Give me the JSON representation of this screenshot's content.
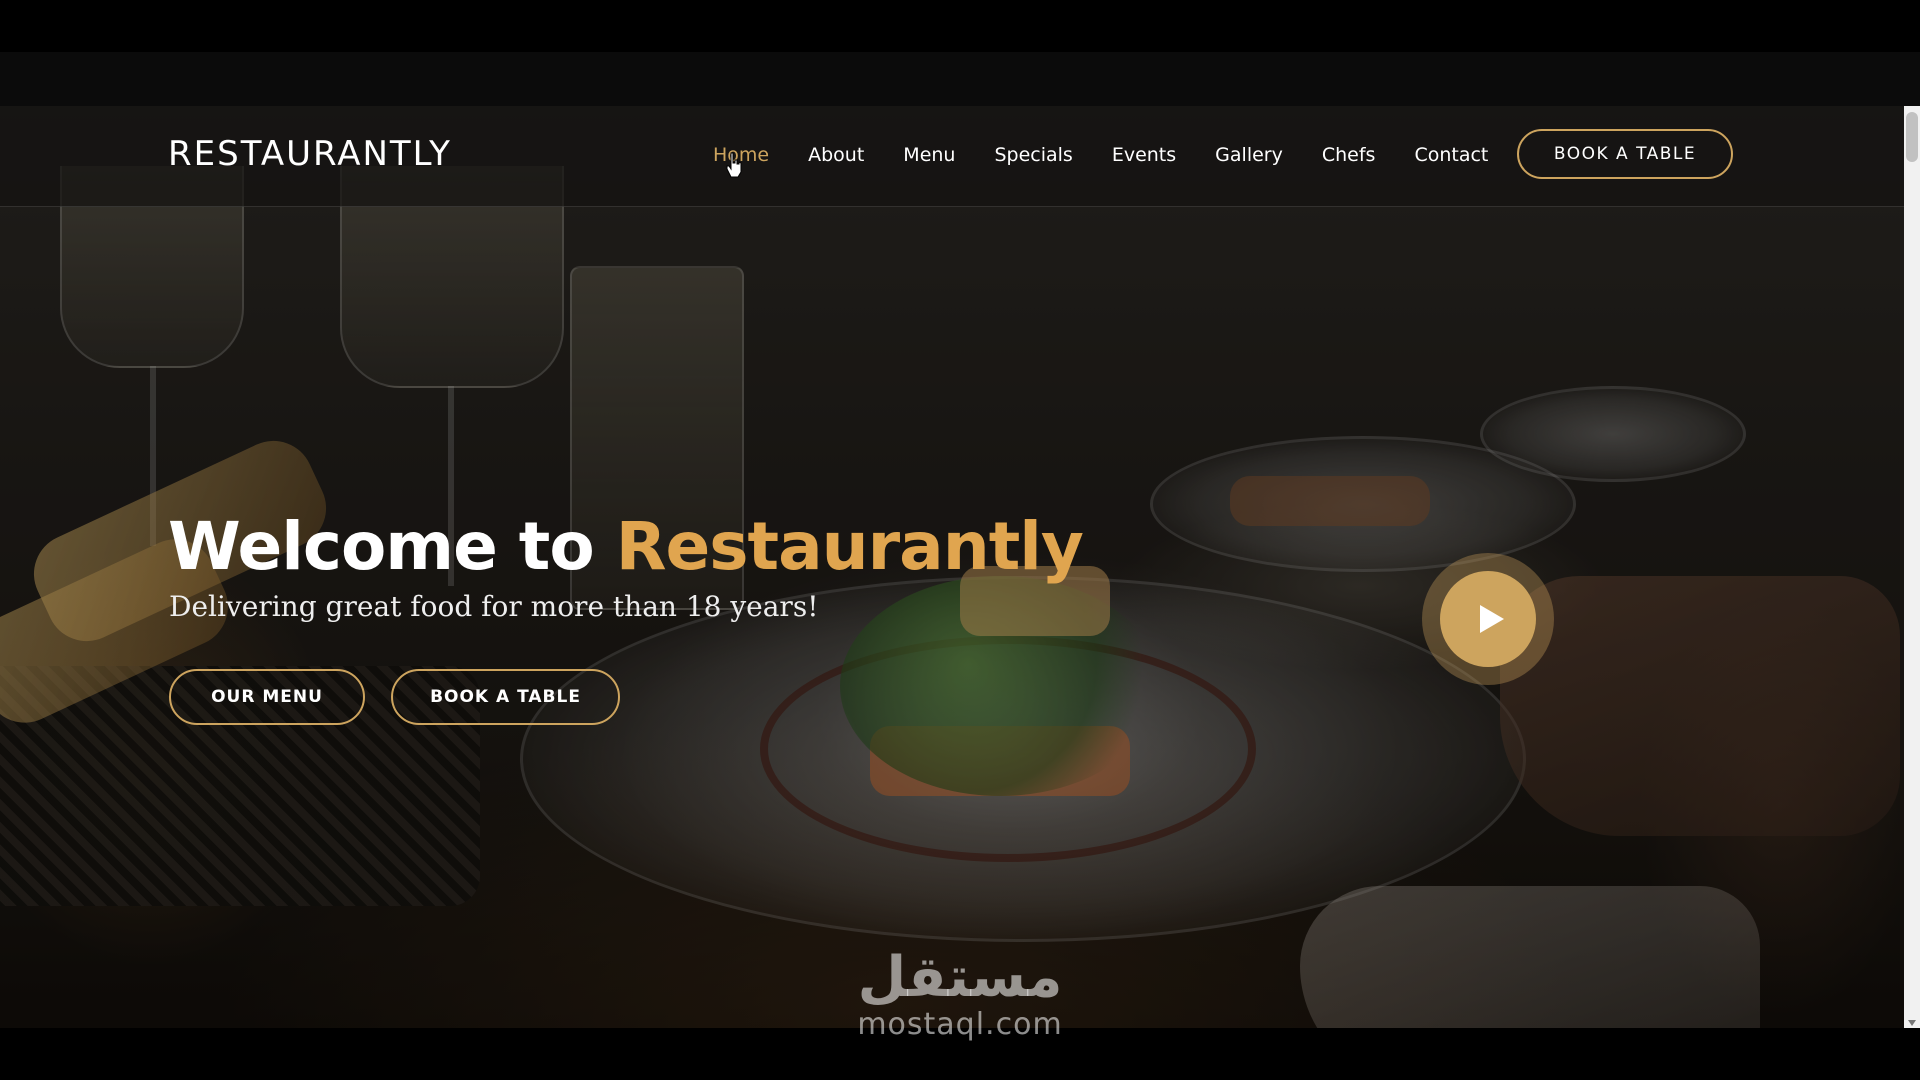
{
  "header": {
    "logo": "RESTAURANTLY",
    "nav": [
      {
        "label": "Home",
        "active": true
      },
      {
        "label": "About",
        "active": false
      },
      {
        "label": "Menu",
        "active": false
      },
      {
        "label": "Specials",
        "active": false
      },
      {
        "label": "Events",
        "active": false
      },
      {
        "label": "Gallery",
        "active": false
      },
      {
        "label": "Chefs",
        "active": false
      },
      {
        "label": "Contact",
        "active": false
      }
    ],
    "cta_label": "BOOK A TABLE"
  },
  "hero": {
    "title_prefix": "Welcome to ",
    "title_accent": "Restaurantly",
    "subtitle": "Delivering great food for more than 18 years!",
    "primary_button": "OUR MENU",
    "secondary_button": "BOOK A TABLE",
    "play_icon": "play-icon"
  },
  "watermark": {
    "arabic": "مستقل",
    "latin": "mostaql.com"
  },
  "colors": {
    "accent": "#cda45e",
    "title_accent": "#e0a54f",
    "header_bg": "rgba(20,18,16,0.72)",
    "text": "#ffffff"
  }
}
